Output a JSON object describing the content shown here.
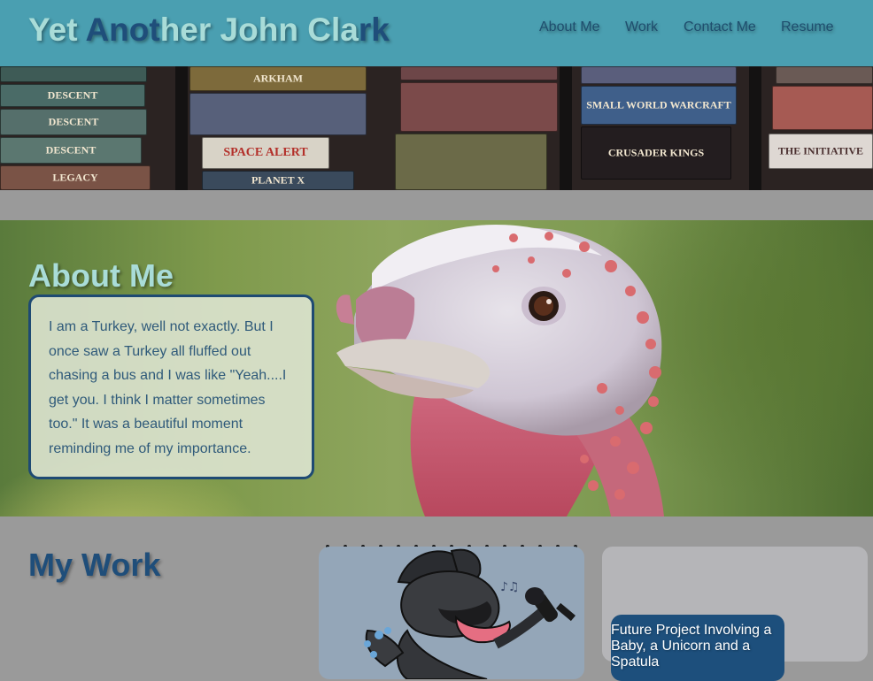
{
  "header": {
    "title_parts": [
      "Yet",
      " Anot",
      "her John Cla",
      "rk"
    ],
    "nav": [
      {
        "label": "About Me"
      },
      {
        "label": "Work"
      },
      {
        "label": "Contact Me"
      },
      {
        "label": "Resume"
      }
    ]
  },
  "hero": {
    "boxes": [
      {
        "text": "DESCENT"
      },
      {
        "text": "DESCENT"
      },
      {
        "text": "DESCENT"
      },
      {
        "text": "LEGACY"
      },
      {
        "text": "SPACE ALERT"
      },
      {
        "text": "PLANET X"
      },
      {
        "text": "ARKHAM"
      },
      {
        "text": "SMALL WORLD WARCRAFT"
      },
      {
        "text": "CRUSADER KINGS"
      },
      {
        "text": "THE INITIATIVE"
      }
    ]
  },
  "about": {
    "heading": "About Me",
    "text": "I am a Turkey, well not exactly. But I once saw a Turkey all fluffed out chasing a bus and I was like \"Yeah....I get you. I think I matter sometimes too.\" It was a beautiful moment reminding me of my importance."
  },
  "work": {
    "heading": "My Work",
    "projects": [
      {
        "label": ""
      },
      {
        "label": "Future Project Involving a Baby, a Unicorn and a Spatula"
      }
    ]
  },
  "colors": {
    "header_bg": "#4a9fb1",
    "title_light": "#a9dcd8",
    "title_dark": "#1f4e7a",
    "page_bg": "#9a9a9a",
    "card_border": "#1e4a73",
    "label_bg": "#1d4f7c"
  }
}
